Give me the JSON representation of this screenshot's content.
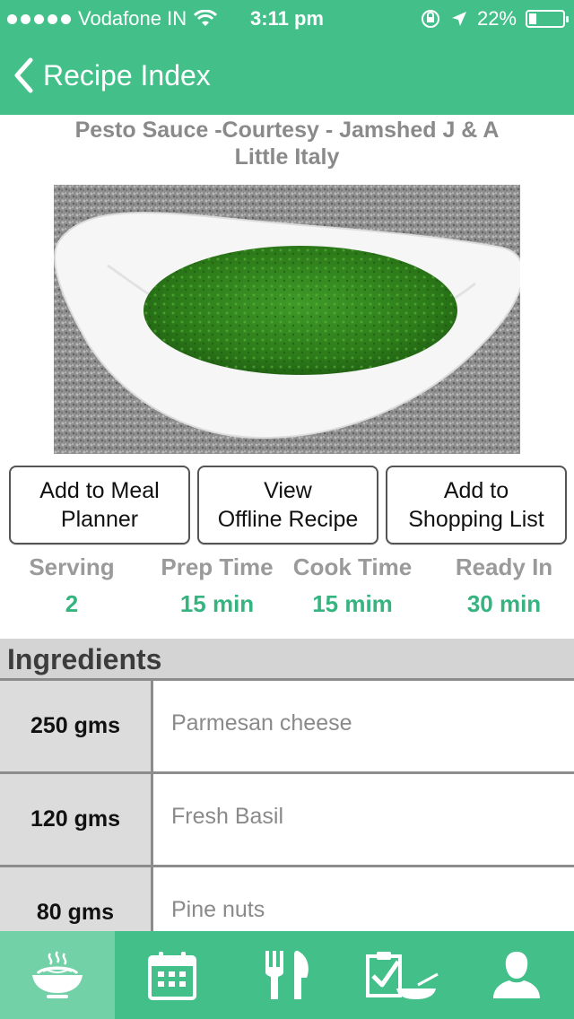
{
  "status_bar": {
    "carrier": "Vodafone IN",
    "time": "3:11 pm",
    "battery": "22%",
    "battery_level": 0.22
  },
  "nav": {
    "back_label": "Recipe Index"
  },
  "recipe": {
    "title": "Pesto Sauce -Courtesy - Jamshed J & A Little Italy"
  },
  "actions": [
    {
      "label": "Add to Meal\nPlanner"
    },
    {
      "label": "View\nOffline Recipe"
    },
    {
      "label": "Add to\nShopping List"
    }
  ],
  "stats": [
    {
      "label": "Serving",
      "value": "2"
    },
    {
      "label": "Prep Time",
      "value": "15 min"
    },
    {
      "label": "Cook Time",
      "value": "15 mim"
    },
    {
      "label": "Ready In",
      "value": "30 min"
    }
  ],
  "ingredients": {
    "header": "Ingredients",
    "rows": [
      {
        "qty": "250 gms",
        "name": "Parmesan cheese"
      },
      {
        "qty": "120 gms",
        "name": "Fresh Basil"
      },
      {
        "qty": "80 gms",
        "name": "Pine nuts"
      }
    ]
  },
  "tabbar": {
    "tabs": [
      {
        "icon": "pasta-bowl-icon",
        "active": true
      },
      {
        "icon": "calendar-icon",
        "active": false
      },
      {
        "icon": "fork-knife-icon",
        "active": false
      },
      {
        "icon": "checklist-icon",
        "active": false
      },
      {
        "icon": "user-icon",
        "active": false
      }
    ]
  },
  "colors": {
    "brand_green": "#43c08a",
    "active_tab": "#72d1a7",
    "value_green": "#35b47f"
  }
}
